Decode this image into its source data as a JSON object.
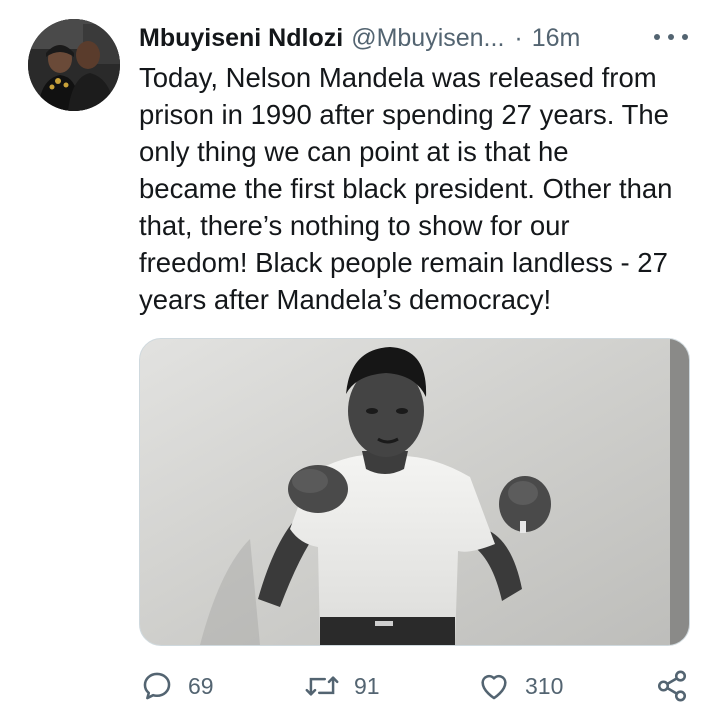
{
  "author": {
    "name": "Mbuyiseni Ndlozi",
    "handle": "@Mbuyisen...",
    "separator": "·",
    "time": "16m"
  },
  "tweet": {
    "lines": [
      "Today, Nelson Mandela was released from",
      "prison in 1990 after spending 27 years. The",
      "only thing we can point at is that he",
      "became the first black president. Other than",
      "that, there’s nothing to show for our",
      "freedom! Black people remain landless - 27",
      "years after Mandela’s democracy!"
    ]
  },
  "actions": {
    "reply_count": "69",
    "retweet_count": "91",
    "like_count": "310"
  },
  "icons": {
    "more": "more-options-icon",
    "reply": "reply-icon",
    "retweet": "retweet-icon",
    "like": "heart-icon",
    "share": "share-icon"
  },
  "colors": {
    "text": "#14171a",
    "secondary": "#536471",
    "media_border": "#cfd9de"
  }
}
